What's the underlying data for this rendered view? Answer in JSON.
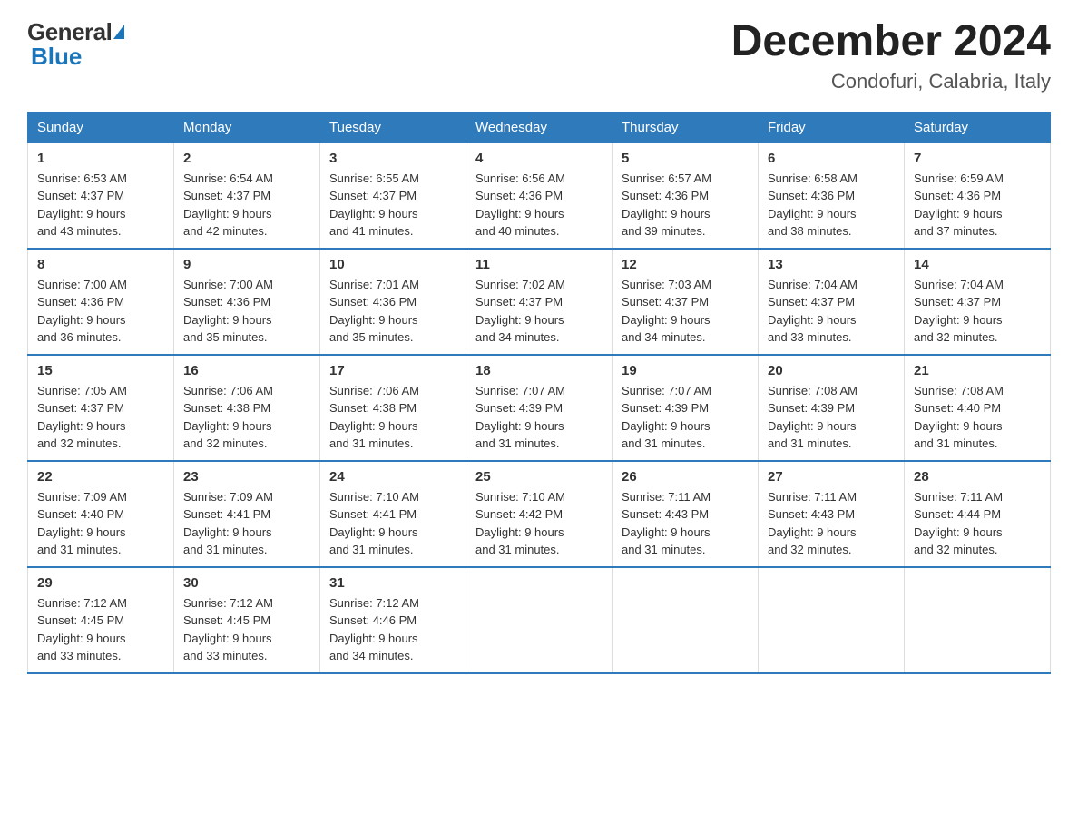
{
  "header": {
    "logo_general": "General",
    "logo_blue": "Blue",
    "month_title": "December 2024",
    "location": "Condofuri, Calabria, Italy"
  },
  "days_of_week": [
    "Sunday",
    "Monday",
    "Tuesday",
    "Wednesday",
    "Thursday",
    "Friday",
    "Saturday"
  ],
  "weeks": [
    [
      {
        "day": "1",
        "sunrise": "6:53 AM",
        "sunset": "4:37 PM",
        "daylight": "9 hours and 43 minutes."
      },
      {
        "day": "2",
        "sunrise": "6:54 AM",
        "sunset": "4:37 PM",
        "daylight": "9 hours and 42 minutes."
      },
      {
        "day": "3",
        "sunrise": "6:55 AM",
        "sunset": "4:37 PM",
        "daylight": "9 hours and 41 minutes."
      },
      {
        "day": "4",
        "sunrise": "6:56 AM",
        "sunset": "4:36 PM",
        "daylight": "9 hours and 40 minutes."
      },
      {
        "day": "5",
        "sunrise": "6:57 AM",
        "sunset": "4:36 PM",
        "daylight": "9 hours and 39 minutes."
      },
      {
        "day": "6",
        "sunrise": "6:58 AM",
        "sunset": "4:36 PM",
        "daylight": "9 hours and 38 minutes."
      },
      {
        "day": "7",
        "sunrise": "6:59 AM",
        "sunset": "4:36 PM",
        "daylight": "9 hours and 37 minutes."
      }
    ],
    [
      {
        "day": "8",
        "sunrise": "7:00 AM",
        "sunset": "4:36 PM",
        "daylight": "9 hours and 36 minutes."
      },
      {
        "day": "9",
        "sunrise": "7:00 AM",
        "sunset": "4:36 PM",
        "daylight": "9 hours and 35 minutes."
      },
      {
        "day": "10",
        "sunrise": "7:01 AM",
        "sunset": "4:36 PM",
        "daylight": "9 hours and 35 minutes."
      },
      {
        "day": "11",
        "sunrise": "7:02 AM",
        "sunset": "4:37 PM",
        "daylight": "9 hours and 34 minutes."
      },
      {
        "day": "12",
        "sunrise": "7:03 AM",
        "sunset": "4:37 PM",
        "daylight": "9 hours and 34 minutes."
      },
      {
        "day": "13",
        "sunrise": "7:04 AM",
        "sunset": "4:37 PM",
        "daylight": "9 hours and 33 minutes."
      },
      {
        "day": "14",
        "sunrise": "7:04 AM",
        "sunset": "4:37 PM",
        "daylight": "9 hours and 32 minutes."
      }
    ],
    [
      {
        "day": "15",
        "sunrise": "7:05 AM",
        "sunset": "4:37 PM",
        "daylight": "9 hours and 32 minutes."
      },
      {
        "day": "16",
        "sunrise": "7:06 AM",
        "sunset": "4:38 PM",
        "daylight": "9 hours and 32 minutes."
      },
      {
        "day": "17",
        "sunrise": "7:06 AM",
        "sunset": "4:38 PM",
        "daylight": "9 hours and 31 minutes."
      },
      {
        "day": "18",
        "sunrise": "7:07 AM",
        "sunset": "4:39 PM",
        "daylight": "9 hours and 31 minutes."
      },
      {
        "day": "19",
        "sunrise": "7:07 AM",
        "sunset": "4:39 PM",
        "daylight": "9 hours and 31 minutes."
      },
      {
        "day": "20",
        "sunrise": "7:08 AM",
        "sunset": "4:39 PM",
        "daylight": "9 hours and 31 minutes."
      },
      {
        "day": "21",
        "sunrise": "7:08 AM",
        "sunset": "4:40 PM",
        "daylight": "9 hours and 31 minutes."
      }
    ],
    [
      {
        "day": "22",
        "sunrise": "7:09 AM",
        "sunset": "4:40 PM",
        "daylight": "9 hours and 31 minutes."
      },
      {
        "day": "23",
        "sunrise": "7:09 AM",
        "sunset": "4:41 PM",
        "daylight": "9 hours and 31 minutes."
      },
      {
        "day": "24",
        "sunrise": "7:10 AM",
        "sunset": "4:41 PM",
        "daylight": "9 hours and 31 minutes."
      },
      {
        "day": "25",
        "sunrise": "7:10 AM",
        "sunset": "4:42 PM",
        "daylight": "9 hours and 31 minutes."
      },
      {
        "day": "26",
        "sunrise": "7:11 AM",
        "sunset": "4:43 PM",
        "daylight": "9 hours and 31 minutes."
      },
      {
        "day": "27",
        "sunrise": "7:11 AM",
        "sunset": "4:43 PM",
        "daylight": "9 hours and 32 minutes."
      },
      {
        "day": "28",
        "sunrise": "7:11 AM",
        "sunset": "4:44 PM",
        "daylight": "9 hours and 32 minutes."
      }
    ],
    [
      {
        "day": "29",
        "sunrise": "7:12 AM",
        "sunset": "4:45 PM",
        "daylight": "9 hours and 33 minutes."
      },
      {
        "day": "30",
        "sunrise": "7:12 AM",
        "sunset": "4:45 PM",
        "daylight": "9 hours and 33 minutes."
      },
      {
        "day": "31",
        "sunrise": "7:12 AM",
        "sunset": "4:46 PM",
        "daylight": "9 hours and 34 minutes."
      },
      null,
      null,
      null,
      null
    ]
  ],
  "labels": {
    "sunrise": "Sunrise:",
    "sunset": "Sunset:",
    "daylight": "Daylight:"
  }
}
